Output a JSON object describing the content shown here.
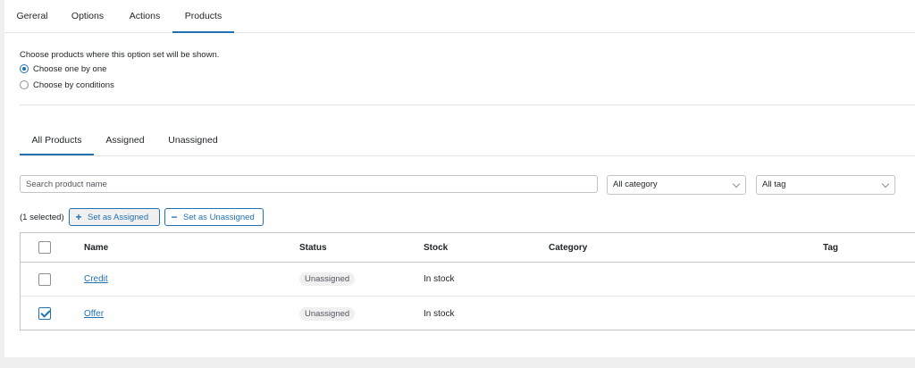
{
  "top_tabs": [
    {
      "label": "Gereral"
    },
    {
      "label": "Options"
    },
    {
      "label": "Actions"
    },
    {
      "label": "Products",
      "active": true
    }
  ],
  "intro": "Choose products where this option set will be shown.",
  "radios": [
    {
      "label": "Choose one by one",
      "checked": true
    },
    {
      "label": "Choose by conditions",
      "checked": false
    }
  ],
  "sub_tabs": [
    {
      "label": "All Products",
      "active": true
    },
    {
      "label": "Assigned"
    },
    {
      "label": "Unassigned"
    }
  ],
  "search": {
    "placeholder": "Search product name",
    "value": ""
  },
  "filters": {
    "category": "All category",
    "tag": "All tag"
  },
  "bulk": {
    "selected": "(1 selected)",
    "assign_label": "Set as Assigned",
    "unassign_label": "Set as Unassigned"
  },
  "table": {
    "headers": {
      "name": "Name",
      "status": "Status",
      "stock": "Stock",
      "category": "Category",
      "tag": "Tag"
    },
    "rows": [
      {
        "name": "Credit",
        "status": "Unassigned",
        "stock": "In stock",
        "category": "",
        "tag": "",
        "checked": false
      },
      {
        "name": "Offer",
        "status": "Unassigned",
        "stock": "In stock",
        "category": "",
        "tag": "",
        "checked": true
      }
    ]
  },
  "colors": {
    "accent": "#2271b1",
    "page_bg": "#f0f0f1",
    "border": "#c3c4c7"
  }
}
